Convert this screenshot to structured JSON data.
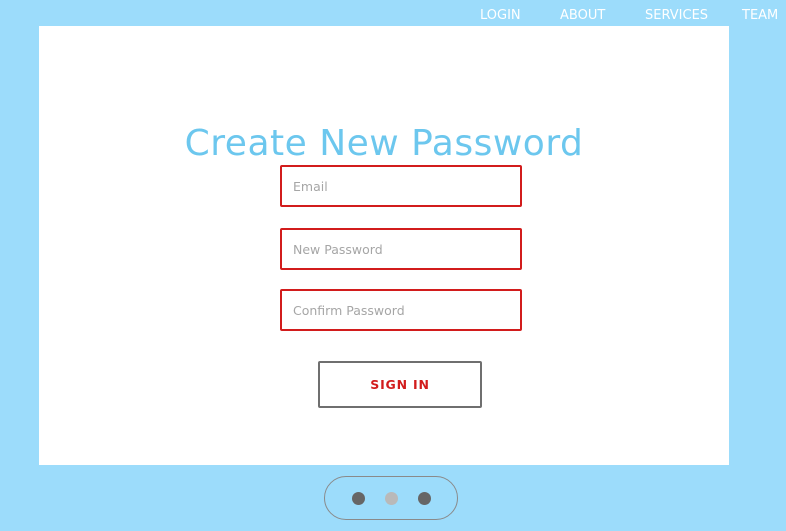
{
  "nav": {
    "items": [
      {
        "label": "LOGIN"
      },
      {
        "label": "ABOUT"
      },
      {
        "label": "SERVICES"
      },
      {
        "label": "TEAM"
      }
    ]
  },
  "form": {
    "title": "Create New Password",
    "email_placeholder": "Email",
    "new_password_placeholder": "New Password",
    "confirm_password_placeholder": "Confirm Password",
    "submit_label": "SIGN IN"
  },
  "pager": {
    "dots": 3,
    "active_index": 2
  },
  "colors": {
    "background": "#9cdcfb",
    "title": "#6cc7ee",
    "field_border": "#d21c1c",
    "button_text": "#d21c1c",
    "button_border": "#6f6f6f",
    "dot_dark": "#666666",
    "dot_active": "#b9b9b9"
  }
}
